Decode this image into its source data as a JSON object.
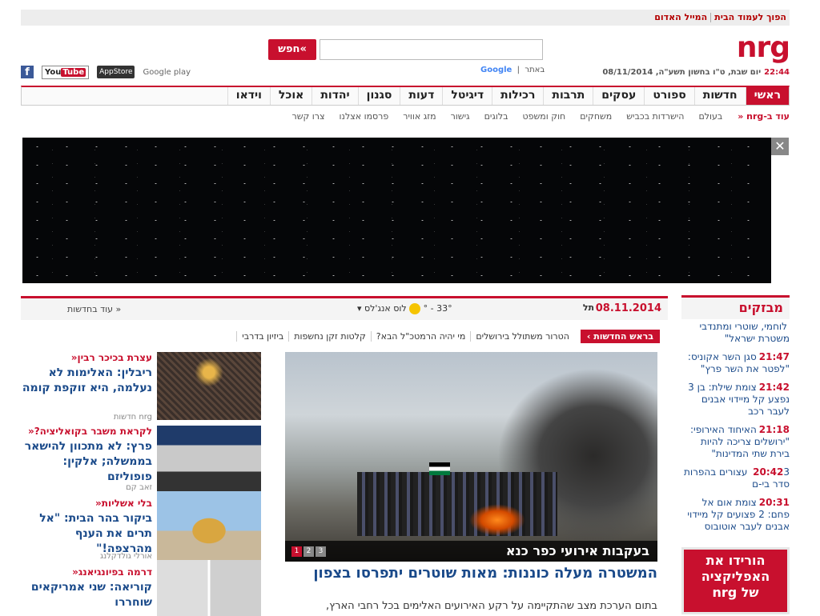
{
  "topbar": {
    "homepage": "הפוך לעמוד הבית",
    "redmail": "המייל האדום"
  },
  "logo": "nrg",
  "dateline": {
    "time": "22:44",
    "text": "יום שבת, ט\"ו בחשון תשע\"ה, 08/11/2014"
  },
  "search": {
    "button": "חפש«",
    "placeholder": "",
    "google": "Google",
    "site": "באתר"
  },
  "social": {
    "facebook": "f",
    "youtube_a": "You",
    "youtube_b": "Tube",
    "appstore": "AppStore",
    "googleplay": "Google play"
  },
  "nav": [
    "ראשי",
    "חדשות",
    "ספורט",
    "עסקים",
    "תרבות",
    "רכילות",
    "דיגיטל",
    "דעות",
    "סגנון",
    "יהדות",
    "אוכל",
    "וידאו"
  ],
  "subnav": {
    "lead": "עוד ב-nrg «",
    "items": [
      "בעולם",
      "הישרדות בכביש",
      "משחקים",
      "חוק ומשפט",
      "בלוגים",
      "גישור",
      "מזג אוויר",
      "פרסמו אצלנו",
      "צרו קשר"
    ]
  },
  "banner": {
    "close": "✕"
  },
  "newsbar": {
    "date": "08.11.2014",
    "city2": "תל",
    "city": "לוס אנג'לס",
    "temp": "33° - °",
    "more": "עוד בחדשות »"
  },
  "ticker": {
    "head": "בראש החדשות ›",
    "items": [
      "הטרור משתולל בירושלים",
      "מי יהיה הרמטכ\"ל הבא?",
      "קלטות זקן נחשפות",
      "ביזיון בדרבי"
    ]
  },
  "hero": {
    "caption": "בעקבות אירועי כפר כנא",
    "pages": [
      "1",
      "2",
      "3"
    ],
    "headline": "המשטרה מעלה כוננות: מאות שוטרים יתפרסו בצפון",
    "lede": "בתום הערכת מצב שהתקיימה על רקע האירועים האלימים בכל רחבי הארץ,"
  },
  "stories": [
    {
      "kicker": "עצרת בכיכר רבין«",
      "title": "ריבלין: האלימות לא נעלמה, היא זוקפת קומה",
      "by": "nrg חדשות"
    },
    {
      "kicker": "לקראת משבר בקואליציה?«",
      "title": "פרץ: לא מתכוון להישאר בממשלה; אלקין: פופוליזם",
      "by": "זאב קם"
    },
    {
      "kicker": "בלי אשליות«",
      "title": "ביקור בהר הבית: \"אל תרים את הענף מהרצפה!\"",
      "by": "אורלי גולדקלנג"
    },
    {
      "kicker": "דרמה בפיונגיאנג«",
      "title": "קוריאה: שני אמריקאים שוחררו",
      "by": ""
    }
  ],
  "flash": {
    "title": "מבזקים",
    "items": [
      {
        "time": "",
        "text": "לוחמי, שוטרי ומתנדבי משטרת ישראל\""
      },
      {
        "time": "21:47",
        "text": "סגן השר אקוניס: \"לפטר את השר פרץ\""
      },
      {
        "time": "21:42",
        "text": "צומת שילת: בן 3 נפצע קל מיידוי אבנים לעבר רכב"
      },
      {
        "time": "21:18",
        "text": "האיחוד האירופי: \"ירושלים צריכה להיות בירת שתי המדינות\""
      },
      {
        "time": "20:42",
        "text": "3 עצורים בהפרות סדר בי-ם"
      },
      {
        "time": "20:31",
        "text": "צומת אום אל פחם: 2 פצועים קל מיידוי אבנים לעבר אוטובוס"
      }
    ]
  },
  "app_ad": {
    "line1": "הורידו את",
    "line2": "האפליקציה",
    "line3": "של nrg"
  }
}
